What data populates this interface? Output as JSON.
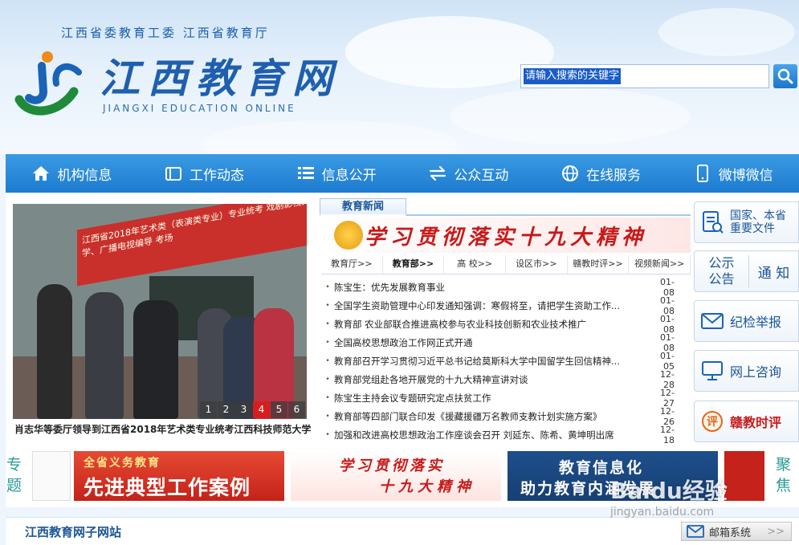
{
  "header": {
    "sub_title": "江西省委教育工委  江西省教育厅",
    "logo_cn": "江西教育网",
    "logo_en": "JIANGXI EDUCATION ONLINE",
    "search_placeholder": "请输入搜索的关键字"
  },
  "nav": [
    {
      "label": "机构信息",
      "icon": "home-icon"
    },
    {
      "label": "工作动态",
      "icon": "folder-icon"
    },
    {
      "label": "信息公开",
      "icon": "list-icon"
    },
    {
      "label": "公众互动",
      "icon": "exchange-icon"
    },
    {
      "label": "在线服务",
      "icon": "globe-icon"
    },
    {
      "label": "微博微信",
      "icon": "phone-icon"
    }
  ],
  "photo": {
    "caption": "肖志华等委厅领导到江西省2018年艺术类专业统考江西科技师范大学",
    "banner_text": "江西省2018年艺术类（表演类专业）专业统考 戏剧影视文学、广播电视编导 考场",
    "pages": [
      "1",
      "2",
      "3",
      "4",
      "5",
      "6"
    ],
    "active_page": "4"
  },
  "news": {
    "tab": "教育新闻",
    "banner": "学习贯彻落实十九大精神",
    "subtabs": [
      "教育厅>>",
      "教育部>>",
      "高 校>>",
      "设区市>>",
      "赣教时评>>",
      "视频新闻>>"
    ],
    "active_subtab": "教育部>>",
    "items": [
      {
        "title": "陈宝生：优先发展教育事业",
        "date": "01-08"
      },
      {
        "title": "全国学生资助管理中心印发通知强调：寒假将至，请把学生资助工作...",
        "date": "01-08"
      },
      {
        "title": "教育部 农业部联合推进高校参与农业科技创新和农业技术推广",
        "date": "01-08"
      },
      {
        "title": "全国高校思想政治工作网正式开通",
        "date": "01-08"
      },
      {
        "title": "教育部召开学习贯彻习近平总书记给莫斯科大学中国留学生回信精神...",
        "date": "01-05"
      },
      {
        "title": "教育部党组赴各地开展党的十九大精神宣讲对谈",
        "date": "12-28"
      },
      {
        "title": "陈宝生主持会议专题研究定点扶贫工作",
        "date": "12-27"
      },
      {
        "title": "教育部等四部门联合印发《援藏援疆万名教师支教计划实施方案》",
        "date": "12-26"
      },
      {
        "title": "加强和改进高校思想政治工作座谈会召开 刘延东、陈希、黄坤明出席",
        "date": "12-18"
      }
    ]
  },
  "side_buttons": [
    {
      "label_1": "国家、本省",
      "label_2": "重要文件",
      "icon": "document-icon"
    },
    {
      "label_1": "公示",
      "label_2": "公告",
      "label_3": "通 知",
      "icon": ""
    },
    {
      "label_1": "纪检举报",
      "icon": "mail-icon"
    },
    {
      "label_1": "网上咨询",
      "icon": "monitor-icon"
    },
    {
      "label_1": "赣教时评",
      "icon": "review-icon"
    }
  ],
  "topics": {
    "left_label": "专题",
    "right_label": "聚焦",
    "t1_line1": "全省义务教育",
    "t1_line2": "先进典型工作案例",
    "t2_line1": "学习贯彻落实",
    "t2_line2": "十九大精神",
    "t3_line1": "教育信息化",
    "t3_line2": "助力教育内涵发展"
  },
  "footer": {
    "subsite_title": "江西教育网子网站",
    "mail_label": "邮箱系统"
  },
  "watermark": {
    "text": "Baidu经验",
    "sub": "jingyan.baidu.com"
  },
  "colors": {
    "nav_blue": "#1d7bd0",
    "brand_blue": "#1a5596",
    "accent_red": "#c71a1a",
    "topic_green": "#2a9c96"
  }
}
